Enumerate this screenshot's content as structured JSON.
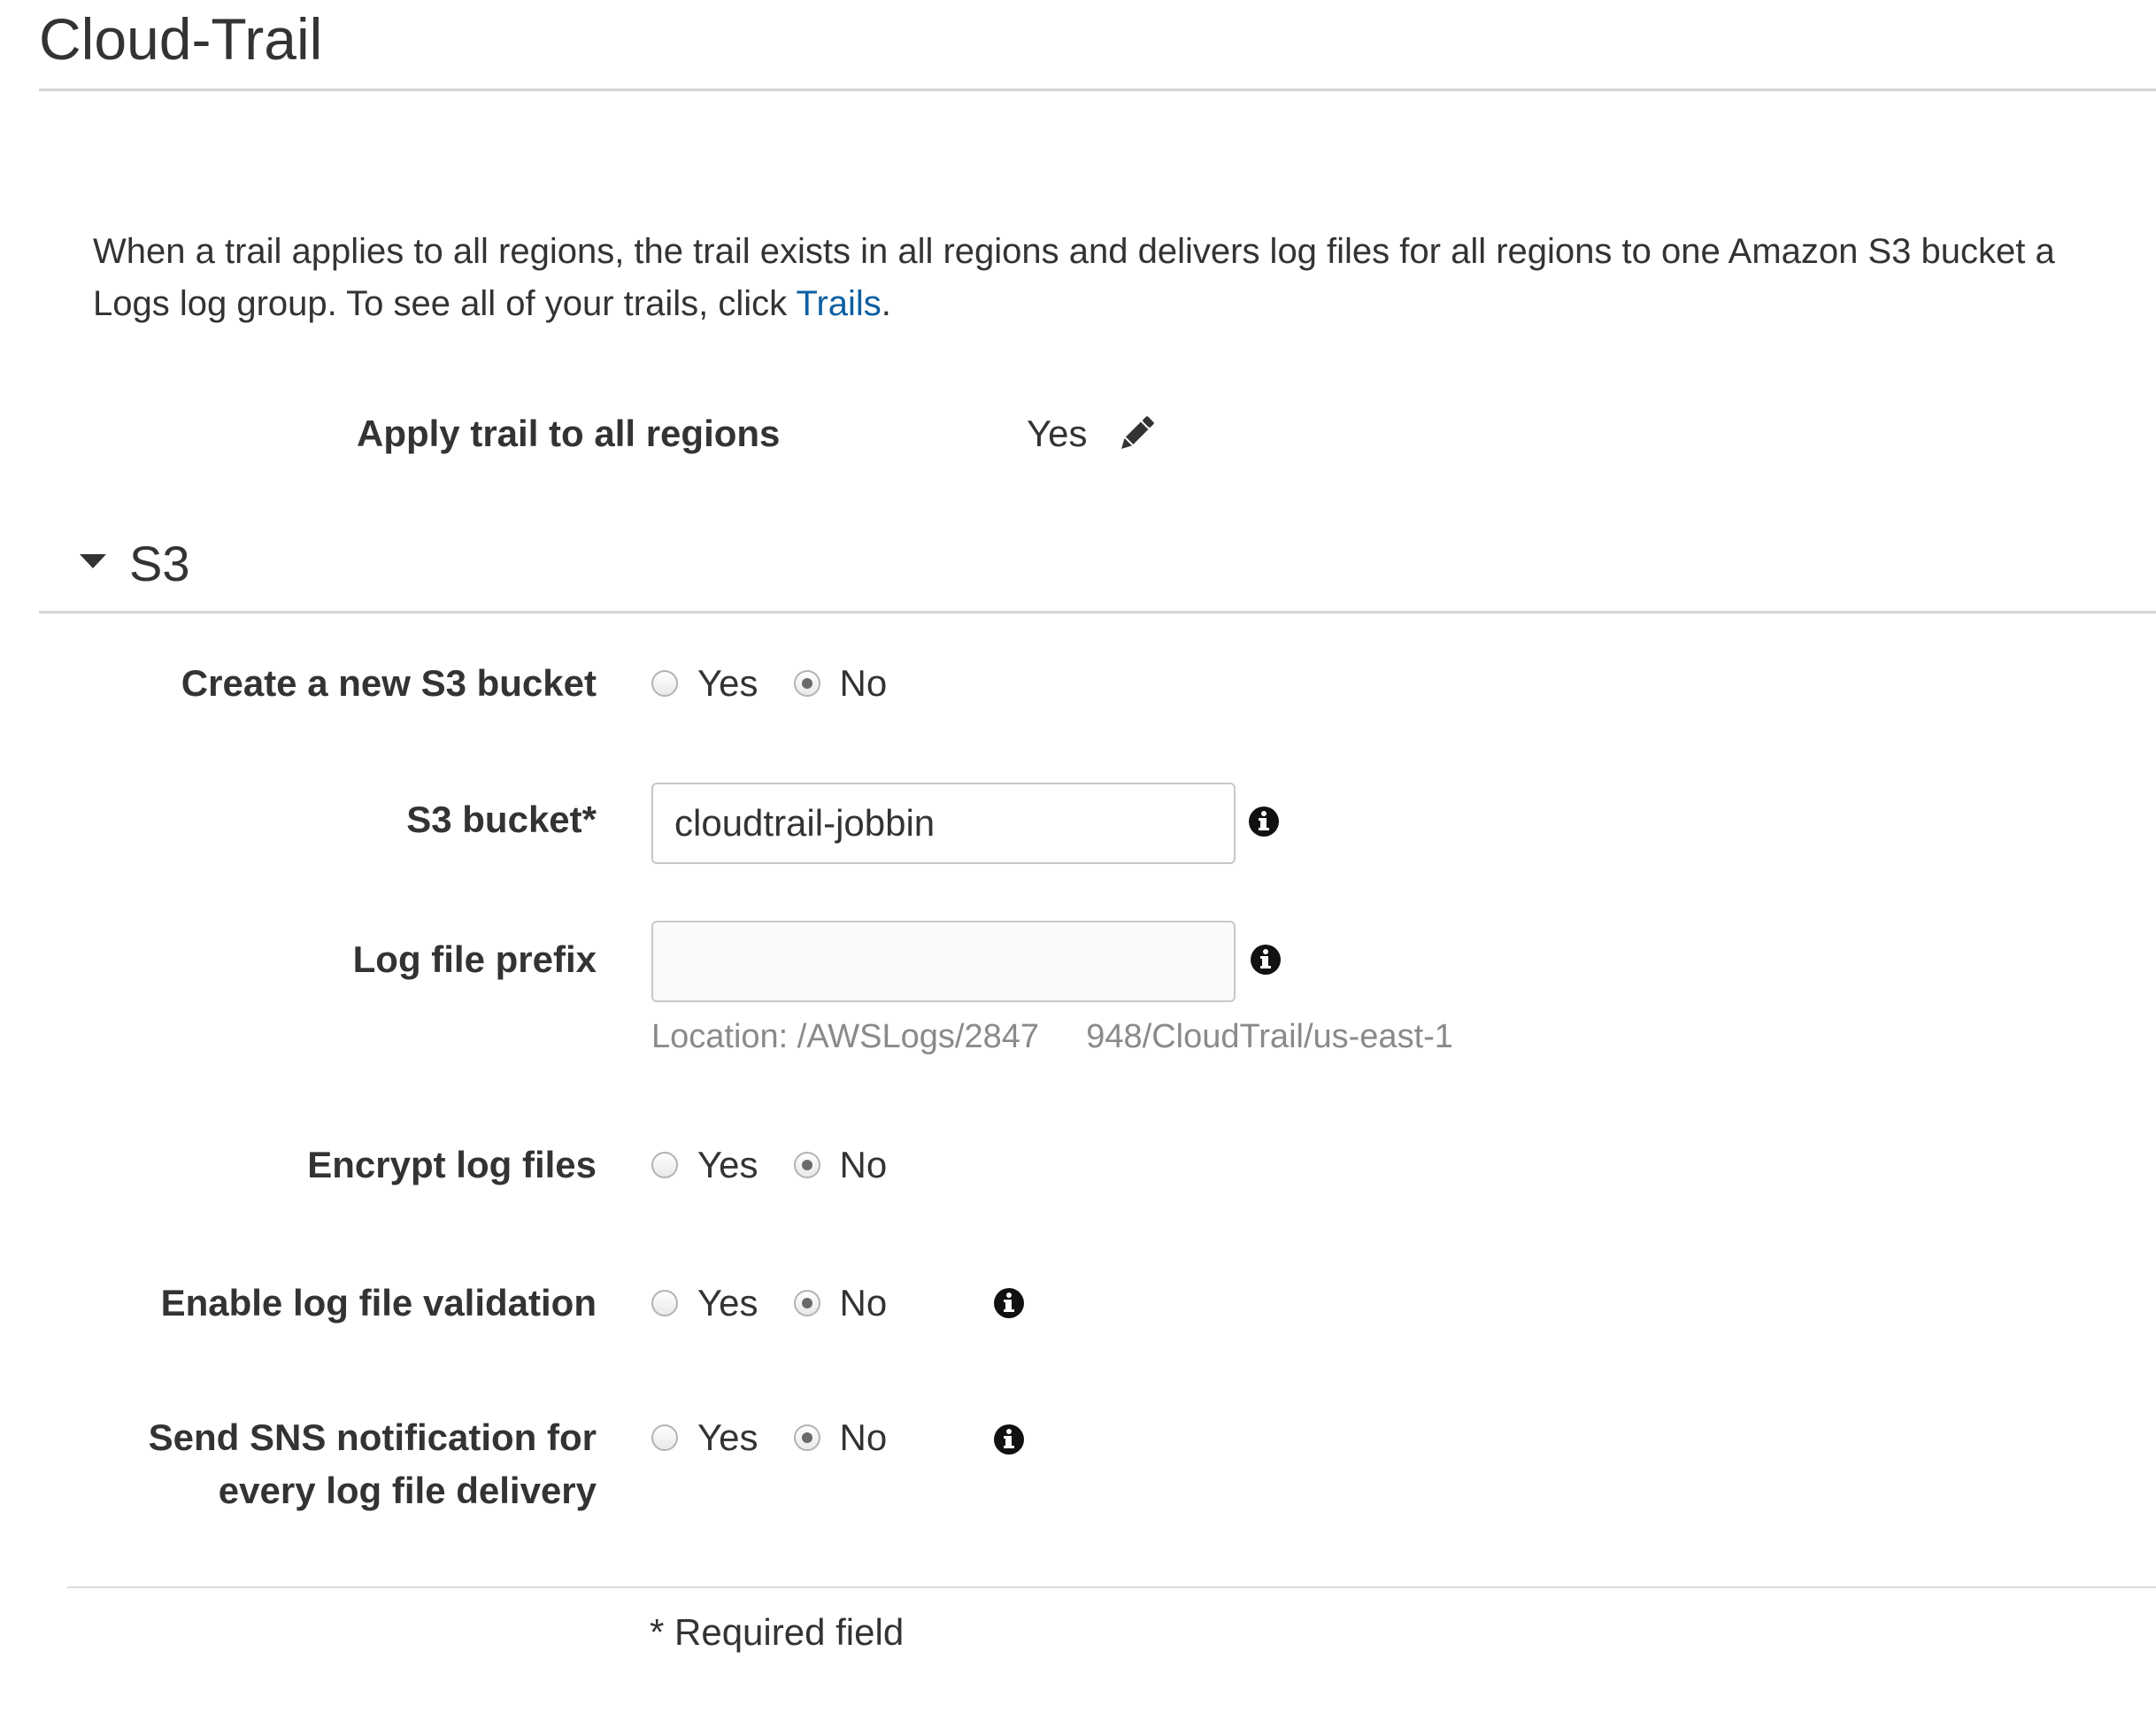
{
  "page": {
    "title": "Cloud-Trail"
  },
  "intro": {
    "line1": "When a trail applies to all regions, the trail exists in all regions and delivers log files for all regions to one Amazon S3 bucket a",
    "line2_prefix": "Logs log group. To see all of your trails, click ",
    "link_text": "Trails",
    "line2_suffix": "."
  },
  "apply_all_regions": {
    "label": "Apply trail to all regions",
    "value": "Yes",
    "edit_icon": "pencil-icon"
  },
  "s3_section": {
    "title": "S3",
    "expanded": true,
    "create_bucket": {
      "label": "Create a new S3 bucket",
      "options": [
        "Yes",
        "No"
      ],
      "selected": "No"
    },
    "bucket": {
      "label": "S3 bucket*",
      "value": "cloudtrail-jobbin",
      "info_icon": "info-icon"
    },
    "log_prefix": {
      "label": "Log file prefix",
      "value": "",
      "info_icon": "info-icon",
      "location_hint": "Location: /AWSLogs/2847       948/CloudTrail/us-east-1"
    },
    "encrypt": {
      "label": "Encrypt log files",
      "options": [
        "Yes",
        "No"
      ],
      "selected": "No"
    },
    "validation": {
      "label": "Enable log file validation",
      "options": [
        "Yes",
        "No"
      ],
      "selected": "No",
      "info_icon": "info-icon"
    },
    "sns": {
      "label_line1": "Send SNS notification for",
      "label_line2": "every log file delivery",
      "options": [
        "Yes",
        "No"
      ],
      "selected": "No",
      "info_icon": "info-icon"
    }
  },
  "footer": {
    "required_note": "* Required field"
  },
  "colors": {
    "text": "#333333",
    "link": "#0a5fa3",
    "rule": "#d5d5d5",
    "hint": "#8a8a8a"
  }
}
